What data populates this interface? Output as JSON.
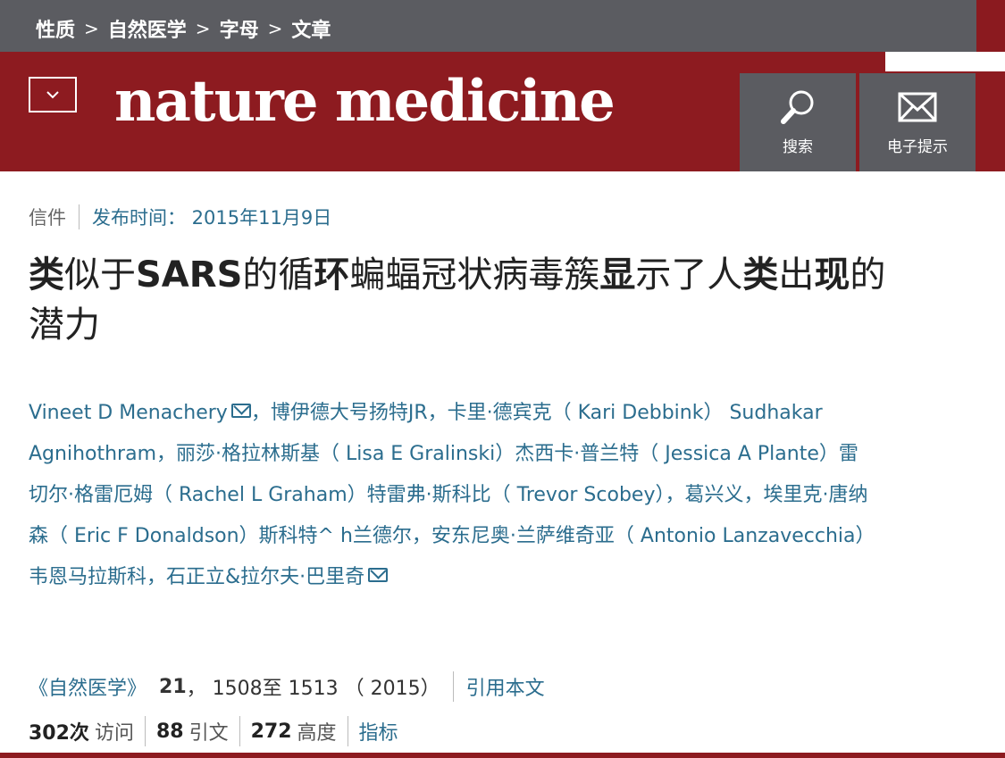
{
  "breadcrumb": {
    "items": [
      "性质",
      "自然医学",
      "字母",
      "文章"
    ],
    "separator": ">"
  },
  "header": {
    "logo": "nature medicine",
    "search_label": "搜索",
    "alerts_label": "电子提示"
  },
  "article": {
    "type": "信件",
    "published": "发布时间：  2015年11月9日",
    "title_parts": [
      {
        "text": "类",
        "bold": true
      },
      {
        "text": "似于",
        "bold": false
      },
      {
        "text": "SARS",
        "bold": true
      },
      {
        "text": "的循",
        "bold": false
      },
      {
        "text": "环",
        "bold": true
      },
      {
        "text": "蝙蝠冠状病毒簇",
        "bold": false
      },
      {
        "text": "显",
        "bold": true
      },
      {
        "text": "示了人",
        "bold": false
      },
      {
        "text": "类",
        "bold": true
      },
      {
        "text": "出",
        "bold": false
      },
      {
        "text": "现",
        "bold": true
      },
      {
        "text": "的潜力",
        "bold": false
      }
    ],
    "authors_line1": "Vineet D Menachery",
    "authors_line2": "，博伊德大号扬特JR，卡里·德宾克（ Kari Debbink） Sudhakar Agnihothram，丽莎·格拉林斯基（ Lisa E Gralinski）杰西卡·普兰特（ Jessica A Plante）雷切尔·格雷厄姆（ Rachel L Graham）特雷弗·斯科比（ Trevor Scobey），葛兴义，埃里克·唐纳森（ Eric F Donaldson）斯科特^ h兰德尔，安东尼奥·兰萨维奇亚（ Antonio Lanzavecchia）韦恩马拉斯科，石正立&拉尔夫·巴里奇",
    "journal": "《自然医学》",
    "volume": "21",
    "pages": "， 1508至 1513 （ 2015）",
    "cite_label": "引用本文"
  },
  "metrics": {
    "accesses_num": "302次",
    "accesses_label": "访问",
    "citations_num": "88",
    "citations_label": "引文",
    "altmetric_num": "272",
    "altmetric_label": "高度",
    "metrics_link": "指标"
  },
  "colors": {
    "brand_red": "#8d1b20",
    "bar_gray": "#5b5c61",
    "link_blue": "#2b6d8e"
  }
}
